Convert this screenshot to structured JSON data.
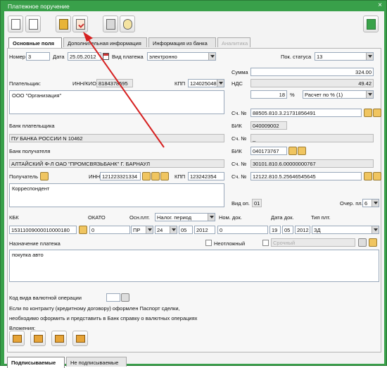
{
  "window": {
    "title": "Платежное поручение"
  },
  "tabs": [
    {
      "label": "Основные поля"
    },
    {
      "label": "Дополнительная информация"
    },
    {
      "label": "Информация из банка"
    },
    {
      "label": "Аналитика"
    }
  ],
  "form": {
    "nomer_label": "Номер",
    "nomer": "3",
    "data_label": "Дата",
    "data": "25.05.2012",
    "vid_plat_label": "Вид платежа",
    "vid_plat": "электронно",
    "pok_status_label": "Пок. статуса",
    "pok_status": "13",
    "summa_label": "Сумма",
    "summa": "324.00",
    "nds_label": "НДС",
    "nds": "49.42",
    "nds_rate": "18",
    "nds_pct": "%",
    "nds_calc": "Расчет по % (1)",
    "payer_label": "Плательщик:",
    "inn_kio_label": "ИНН/КИО",
    "payer_inn": "8184378595",
    "kpp_label": "КПП",
    "payer_kpp": "124025048",
    "payer_name": "ООО \"Организация\"",
    "sch_label": "Сч. №",
    "payer_account": "88505.810.3.21731856491",
    "payer_bank_label": "Банк плательщика",
    "bik_label": "БИК",
    "payer_bik": "040009002",
    "payer_bank": "ПУ БАНКА РОССИИ N 10462",
    "payer_corr": "_",
    "recv_bank_label": "Банк получателя",
    "recv_bik": "040173767",
    "recv_bank": "АЛТАЙСКИЙ Ф-Л ОАО \"ПРОМСВЯЗЬБАНК\" Г. БАРНАУЛ",
    "recv_corr": "30101.810.6.00000000767",
    "recipient_label": "Получатель",
    "inn_label": "ИНН",
    "recv_inn": "121223321334",
    "recv_kpp": "123242354",
    "recv_account": "12122.810.5.25646545645",
    "recv_name": "Корреспондент",
    "vid_op_label": "Вид оп.",
    "vid_op": "01",
    "ocher_label": "Очер. пл.",
    "ocher": "6",
    "kbk_label": "КБК",
    "okato_label": "ОКАТО",
    "osn_label": "Осн.плт.",
    "nalog_period_label": "Налог. период",
    "nom_dok_label": "Ном. док.",
    "data_dok_label": "Дата док.",
    "tip_plt_label": "Тип плт.",
    "kbk": "15311009000010000180",
    "okato": "0",
    "osn": "ПР",
    "period_1": "24",
    "period_2": "05",
    "period_3": "2012",
    "nom_dok": "0",
    "dok_day": "19",
    "dok_month": "05",
    "dok_year": "2012",
    "tip_plt": "ЗД",
    "purpose_label": "Назначение платежа",
    "urgent_label": "Неотложный",
    "urgent_field": "Срочный",
    "purpose": "покупка авто",
    "currency_op_label": "Код вида валютной операции",
    "note_1": "Если по контракту (кредитному договору) оформлен Паспорт сделки,",
    "note_2": "необходимо оформить и представить в Банк справку о валютных операциях",
    "attachments_label": "Вложения:"
  },
  "bottom_tabs": [
    {
      "label": "Подписываемые"
    },
    {
      "label": "Не подписываемые"
    }
  ],
  "colors": {
    "window_green": "#39a04a",
    "annotation_arrow": "#d62020"
  }
}
